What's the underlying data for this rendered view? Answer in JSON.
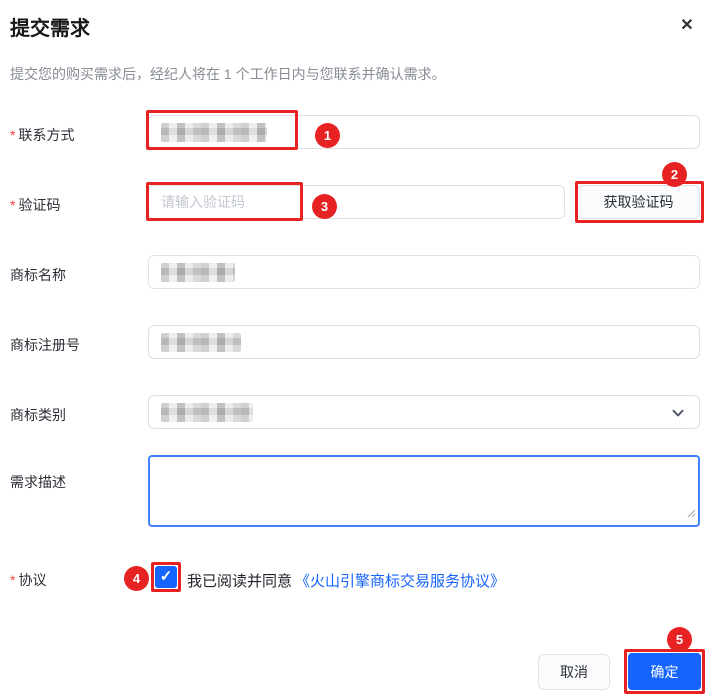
{
  "dialog": {
    "title": "提交需求",
    "subtitle": "提交您的购买需求后，经纪人将在 1 个工作日内与您联系并确认需求。",
    "close_icon": "✕"
  },
  "form": {
    "required_mark": "*",
    "fields": [
      {
        "label": "联系方式",
        "required": true,
        "value_blurred": true
      },
      {
        "label": "验证码",
        "required": true,
        "placeholder": "请输入验证码",
        "button_label": "获取验证码"
      },
      {
        "label": "商标名称",
        "required": false,
        "value_blurred": true
      },
      {
        "label": "商标注册号",
        "required": false,
        "value_blurred": true
      },
      {
        "label": "商标类别",
        "required": false,
        "value_blurred": true,
        "control": "select"
      },
      {
        "label": "需求描述",
        "required": false,
        "control": "textarea",
        "value": ""
      },
      {
        "label": "协议",
        "required": true,
        "control": "checkbox",
        "checked": true,
        "check_icon": "✓",
        "agree_text": "我已阅读并同意",
        "agreement_link": "《火山引擎商标交易服务协议》"
      }
    ]
  },
  "footer": {
    "cancel_label": "取消",
    "confirm_label": "确定"
  },
  "annotations": {
    "color": "#e62222",
    "steps": [
      "1",
      "2",
      "3",
      "4",
      "5"
    ]
  },
  "colors": {
    "primary_blue": "#1664ff",
    "link_blue": "#1664ff",
    "annotation_red": "#e62222",
    "required_red": "#f53f3f",
    "input_border": "#dee0e3",
    "textarea_focus_border": "#4080ff"
  }
}
